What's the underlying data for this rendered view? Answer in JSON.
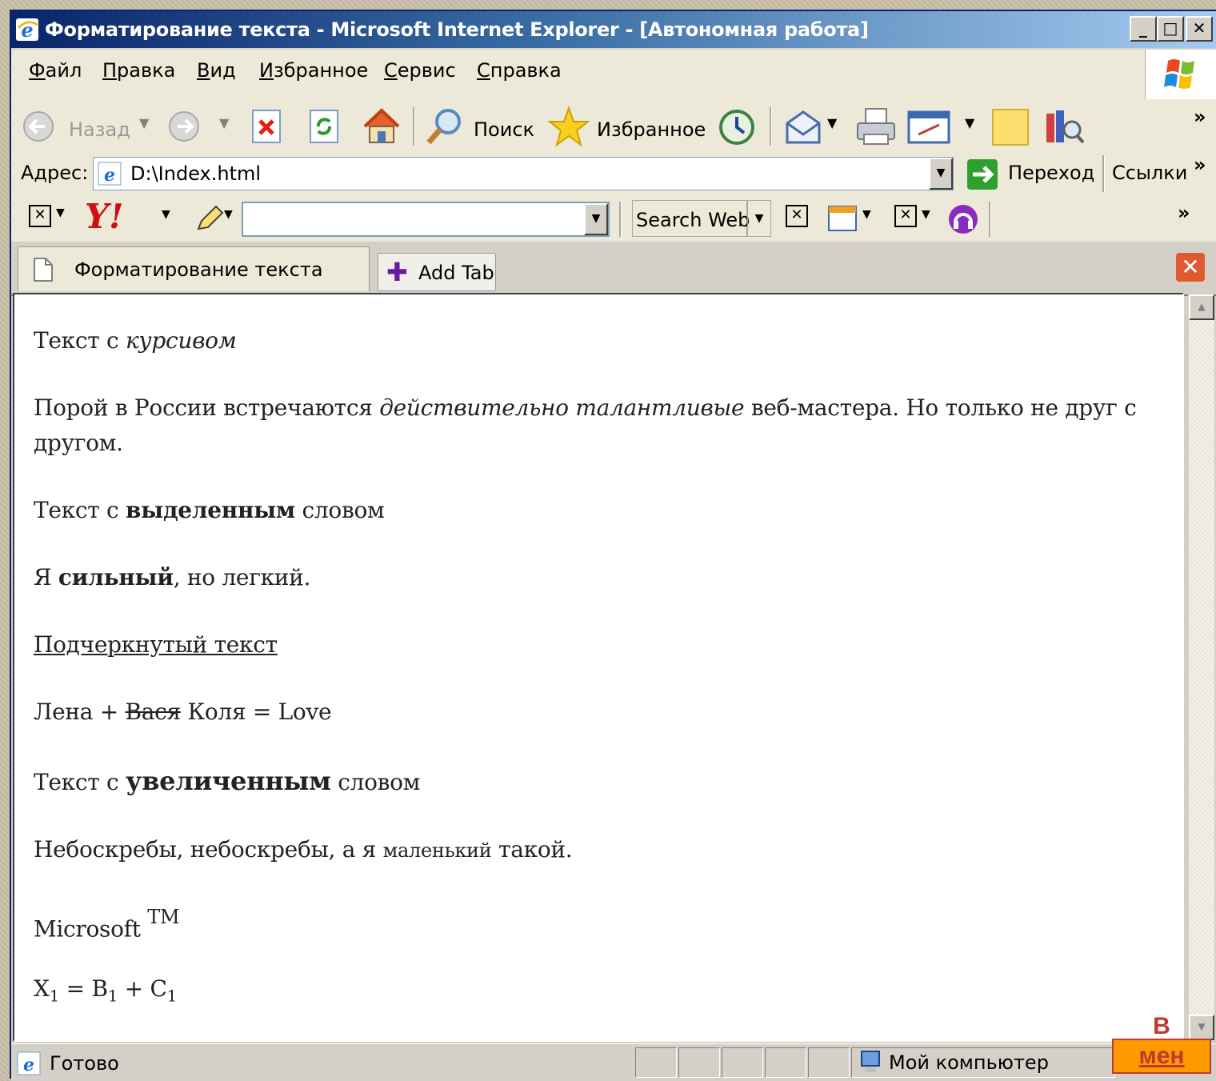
{
  "window": {
    "title": "Форматирование текста - Microsoft Internet Explorer - [Автономная работа]",
    "controls": [
      "_",
      "□",
      "✕"
    ]
  },
  "menubar": {
    "items": [
      "Файл",
      "Правка",
      "Вид",
      "Избранное",
      "Сервис",
      "Справка"
    ]
  },
  "toolbar": {
    "back_label": "Назад",
    "search_label": "Поиск",
    "favorites_label": "Избранное",
    "more": "»"
  },
  "addressbar": {
    "label": "Адрес:",
    "value": "D:\\Index.html",
    "go_label": "Переход",
    "links_label": "Ссылки",
    "more": "»"
  },
  "yahoo_toolbar": {
    "logo": "Y!",
    "search_value": "",
    "search_web_label": "Search Web",
    "more": "»"
  },
  "tabs": {
    "active_tab": "Форматирование текста",
    "add_tab_label": "Add Tab"
  },
  "document": {
    "line1": {
      "a": "Текст с ",
      "b": "курсивом"
    },
    "line2": {
      "a": "Порой в России встречаются ",
      "b": "действительно талантливые",
      "c": " веб-мастера. Но только не друг с другом."
    },
    "line3": {
      "a": "Текст с ",
      "b": "выделенным",
      "c": " словом"
    },
    "line4": {
      "a": "Я ",
      "b": "сильный",
      "c": ", но легкий."
    },
    "line5": {
      "a": "Подчеркнутый текст"
    },
    "line6": {
      "a": "Лена + ",
      "b": "Вася",
      "c": " Коля = Love"
    },
    "line7": {
      "a": "Текст с ",
      "b": "увеличенным",
      "c": " словом"
    },
    "line8": {
      "a": "Небоскребы, небоскребы, а я ",
      "b": "маленький",
      "c": " такой."
    },
    "line9": {
      "a": "Microsoft ",
      "b": "TM"
    },
    "line10": {
      "x": "X",
      "x1": "1",
      "eq": " = B",
      "b1": "1",
      "plus": " + C",
      "c1": "1"
    }
  },
  "statusbar": {
    "status": "Готово",
    "zone": "Мой компьютер"
  },
  "overlay": {
    "label": "В",
    "menu": "мен"
  },
  "colors": {
    "title_start": "#0a246a",
    "title_end": "#a6caf0",
    "overlay_bg": "#ff9900",
    "overlay_text": "#c0392b"
  }
}
